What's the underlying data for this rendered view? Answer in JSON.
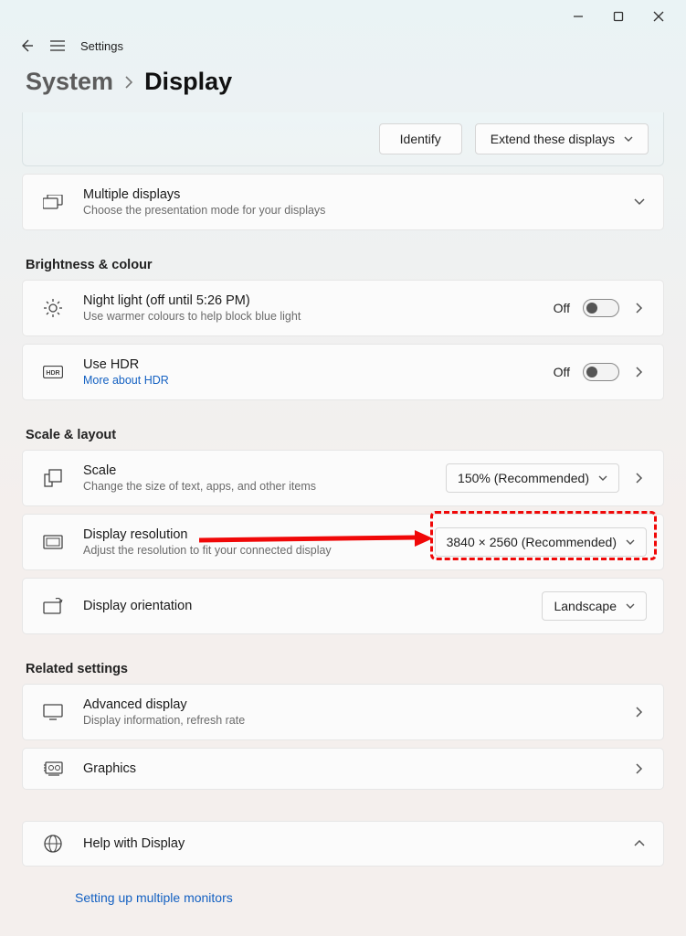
{
  "window": {
    "app": "Settings"
  },
  "breadcrumb": {
    "parent": "System",
    "current": "Display"
  },
  "top_panel": {
    "identify": "Identify",
    "extend": "Extend these displays"
  },
  "multiple_displays": {
    "title": "Multiple displays",
    "sub": "Choose the presentation mode for your displays"
  },
  "sections": {
    "brightness": "Brightness & colour",
    "scale": "Scale & layout",
    "related": "Related settings"
  },
  "night_light": {
    "title": "Night light (off until 5:26 PM)",
    "sub": "Use warmer colours to help block blue light",
    "state": "Off"
  },
  "hdr": {
    "title": "Use HDR",
    "link": "More about HDR",
    "state": "Off"
  },
  "scale_row": {
    "title": "Scale",
    "sub": "Change the size of text, apps, and other items",
    "value": "150% (Recommended)"
  },
  "resolution_row": {
    "title": "Display resolution",
    "sub": "Adjust the resolution to fit your connected display",
    "value": "3840 × 2560 (Recommended)"
  },
  "orientation_row": {
    "title": "Display orientation",
    "value": "Landscape"
  },
  "advanced": {
    "title": "Advanced display",
    "sub": "Display information, refresh rate"
  },
  "graphics": {
    "title": "Graphics"
  },
  "help": {
    "title": "Help with Display",
    "link1": "Setting up multiple monitors"
  }
}
